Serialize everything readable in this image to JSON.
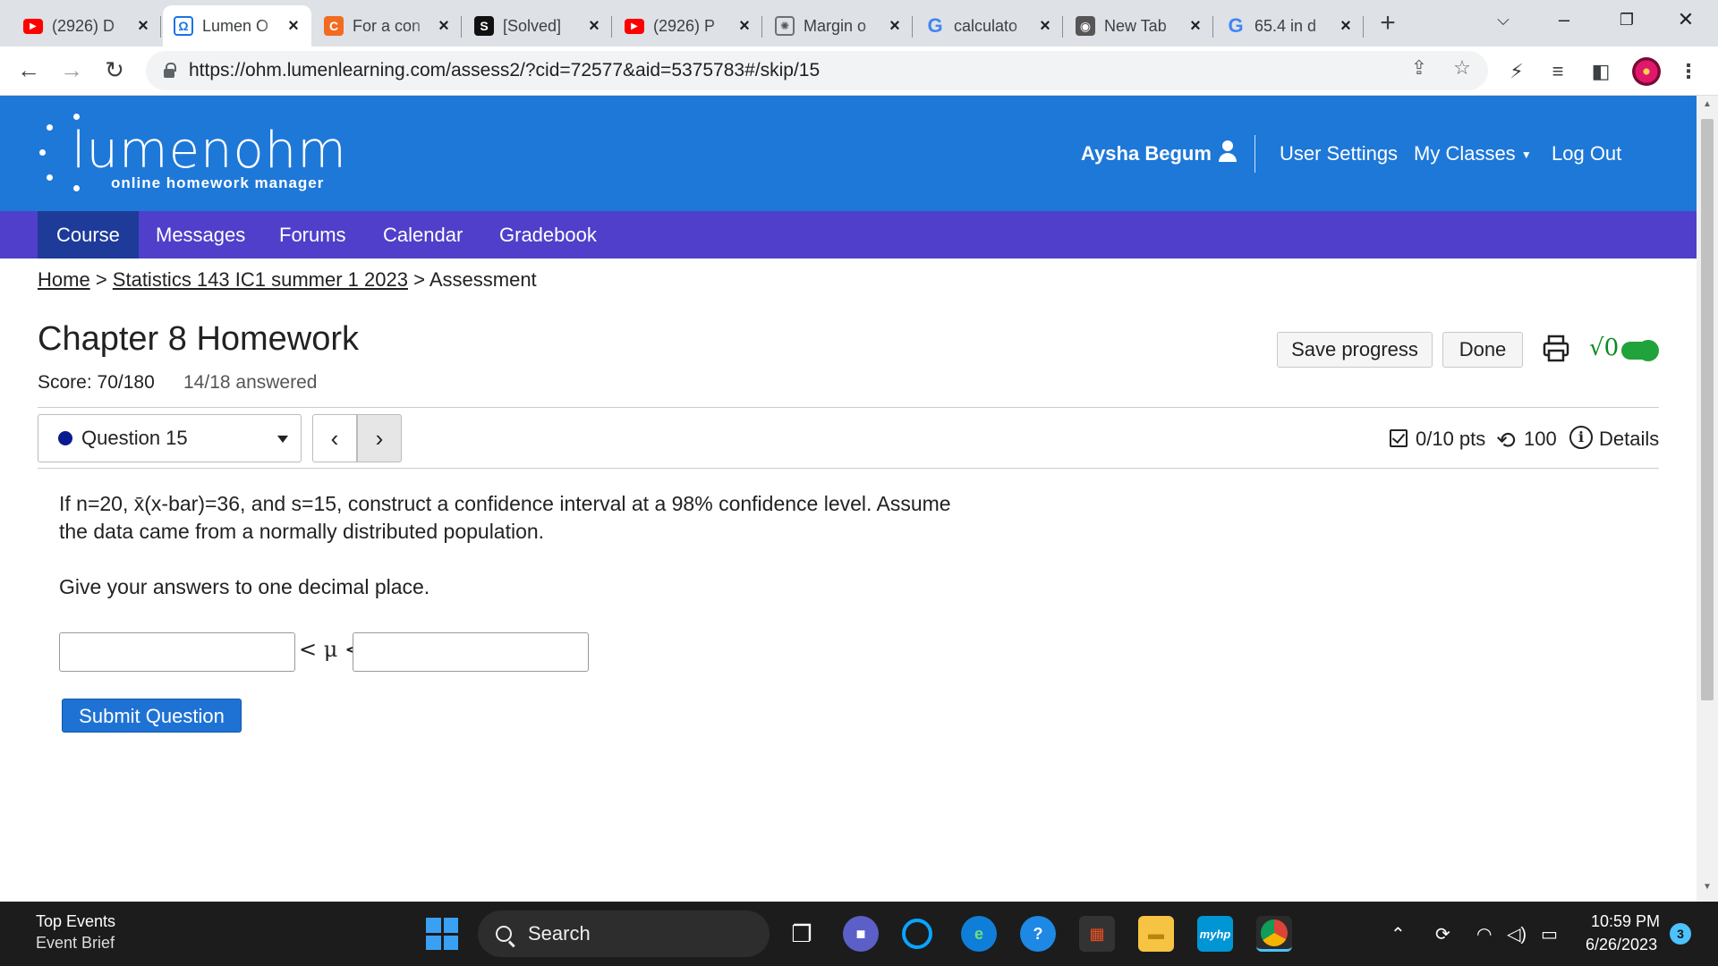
{
  "browser": {
    "tabs": [
      {
        "title": "(2926) D",
        "favicon": "youtube-icon",
        "active": false
      },
      {
        "title": "Lumen O",
        "favicon": "lumen-icon",
        "active": true
      },
      {
        "title": "For a con",
        "favicon": "chegg-icon",
        "active": false
      },
      {
        "title": "[Solved]",
        "favicon": "studocu-icon",
        "active": false
      },
      {
        "title": "(2926) P",
        "favicon": "youtube-icon",
        "active": false
      },
      {
        "title": "Margin o",
        "favicon": "chatgpt-icon",
        "active": false
      },
      {
        "title": "calculato",
        "favicon": "google-icon",
        "active": false
      },
      {
        "title": "New Tab",
        "favicon": "chrome-icon",
        "active": false
      },
      {
        "title": "65.4 in d",
        "favicon": "google-icon",
        "active": false
      }
    ],
    "url": "https://ohm.lumenlearning.com/assess2/?cid=72577&aid=5375783#/skip/15"
  },
  "header": {
    "logo_text": "lumenohm",
    "logo_subtitle": "online homework manager",
    "user_name": "Aysha Begum",
    "links": {
      "settings": "User Settings",
      "classes": "My Classes",
      "logout": "Log Out"
    }
  },
  "nav": {
    "items": [
      {
        "label": "Course",
        "active": true
      },
      {
        "label": "Messages"
      },
      {
        "label": "Forums"
      },
      {
        "label": "Calendar"
      },
      {
        "label": "Gradebook"
      }
    ]
  },
  "breadcrumb": {
    "home": "Home",
    "sep1": ">",
    "course": "Statistics 143 IC1 summer 1 2023",
    "sep2": ">",
    "current": "Assessment"
  },
  "assessment": {
    "title": "Chapter 8 Homework",
    "score": "Score: 70/180",
    "answered": "14/18 answered",
    "save_label": "Save progress",
    "done_label": "Done",
    "math_toggle_label": "√0"
  },
  "question": {
    "selector_label": "Question 15",
    "points": "0/10 pts",
    "attempts": "100",
    "details_label": "Details",
    "text_line1": "If n=20, x̄(x-bar)=36, and s=15, construct a confidence interval at a 98% confidence level. Assume",
    "text_line2": "the data came from a normally distributed population.",
    "instruction": "Give your answers to one decimal place.",
    "lower_value": "",
    "upper_value": "",
    "middle_expr": "< μ <",
    "submit_label": "Submit Question"
  },
  "taskbar": {
    "news_title": "Top Events",
    "news_subtitle": "Event Brief",
    "search_label": "Search",
    "time": "10:59 PM",
    "date": "6/26/2023",
    "notifications": "3"
  }
}
